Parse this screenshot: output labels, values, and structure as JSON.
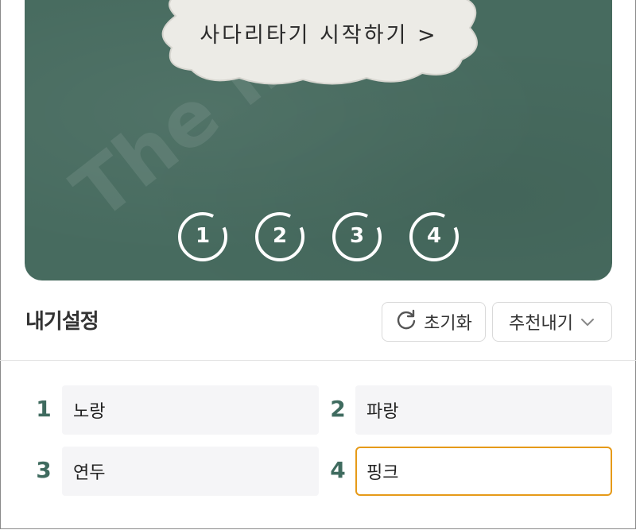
{
  "board": {
    "start_label": "사다리타기 시작하기 >",
    "watermark": "The image I made",
    "players": [
      "1",
      "2",
      "3",
      "4"
    ]
  },
  "settings": {
    "title": "내기설정",
    "reset_label": "초기화",
    "recommend_label": "추천내기"
  },
  "entries": [
    {
      "num": "1",
      "value": "노랑"
    },
    {
      "num": "2",
      "value": "파랑"
    },
    {
      "num": "3",
      "value": "연두"
    },
    {
      "num": "4",
      "value": "핑크"
    }
  ],
  "colors": {
    "board": "#476b5f",
    "accent_number": "#3f6b5f",
    "focus_border": "#e69a18",
    "input_bg": "#f5f5f7"
  },
  "icons": {
    "reset": "refresh-icon",
    "dropdown": "chevron-down-icon"
  }
}
